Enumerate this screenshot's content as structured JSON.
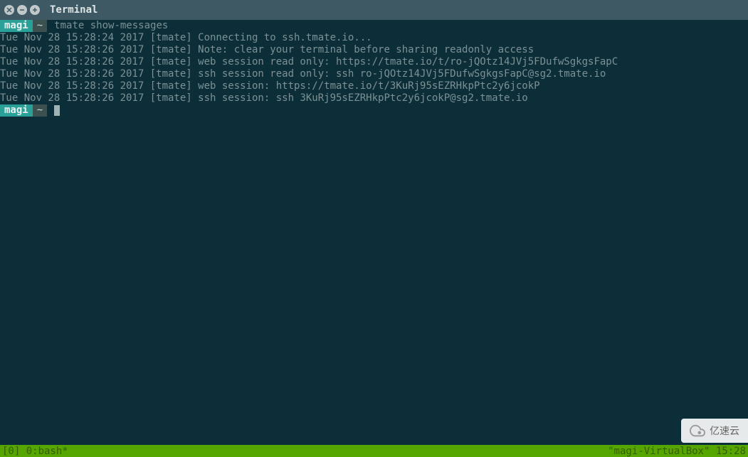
{
  "window": {
    "title": "Terminal"
  },
  "prompts": [
    {
      "user": "magi",
      "path": "~",
      "command": "tmate show-messages"
    },
    {
      "user": "magi",
      "path": "~",
      "command": ""
    }
  ],
  "output_lines": [
    "Tue Nov 28 15:28:24 2017 [tmate] Connecting to ssh.tmate.io...",
    "Tue Nov 28 15:28:26 2017 [tmate] Note: clear your terminal before sharing readonly access",
    "Tue Nov 28 15:28:26 2017 [tmate] web session read only: https://tmate.io/t/ro-jQOtz14JVj5FDufwSgkgsFapC",
    "Tue Nov 28 15:28:26 2017 [tmate] ssh session read only: ssh ro-jQOtz14JVj5FDufwSgkgsFapC@sg2.tmate.io",
    "Tue Nov 28 15:28:26 2017 [tmate] web session: https://tmate.io/t/3KuRj95sEZRHkpPtc2y6jcokP",
    "Tue Nov 28 15:28:26 2017 [tmate] ssh session: ssh 3KuRj95sEZRHkpPtc2y6jcokP@sg2.tmate.io"
  ],
  "statusbar": {
    "left": "[0] 0:bash*",
    "right": "\"magi-VirtualBox\" 15:28"
  },
  "watermark": {
    "text": "亿速云"
  }
}
